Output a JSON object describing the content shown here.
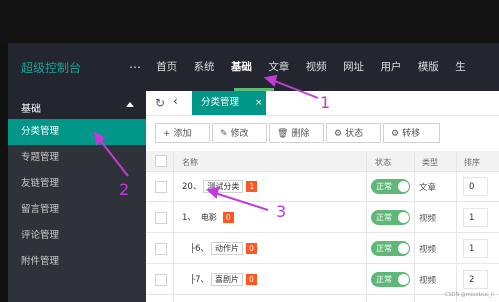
{
  "header": {
    "brand": "超级控制台",
    "more": "…",
    "nav": [
      "首页",
      "系统",
      "基础",
      "文章",
      "视频",
      "网址",
      "用户",
      "模版",
      "生"
    ],
    "active_nav": "基础"
  },
  "sidebar": {
    "section": "基础",
    "items": [
      "分类管理",
      "专题管理",
      "友链管理",
      "留言管理",
      "评论管理",
      "附件管理"
    ],
    "active_item": "分类管理"
  },
  "tabs": {
    "active_tab": "分类管理",
    "close": "×"
  },
  "toolbar": {
    "add": "添加",
    "edit": "修改",
    "delete": "删除",
    "status": "状态",
    "transfer": "转移"
  },
  "table": {
    "columns": {
      "name": "名称",
      "status": "状态",
      "type": "类型",
      "sort": "排序"
    },
    "rows": [
      {
        "prefix": "20、",
        "label": "测试分类",
        "badge": "1",
        "status": "正常",
        "type": "文章",
        "sort": "0"
      },
      {
        "prefix": "1、",
        "label": "电影",
        "badge": "0",
        "status": "正常",
        "type": "视频",
        "sort": "1"
      },
      {
        "prefix": "├6、",
        "label": "动作片",
        "badge": "0",
        "status": "正常",
        "type": "视频",
        "sort": "1"
      },
      {
        "prefix": "├7、",
        "label": "喜剧片",
        "badge": "0",
        "status": "正常",
        "type": "视频",
        "sort": "2"
      }
    ]
  },
  "annotations": [
    "1",
    "2",
    "3"
  ],
  "watermark": "CSDN @moudzuc_li",
  "colors": {
    "accent": "#009688",
    "header_bg": "#23262e",
    "sidebar_bg": "#2f3238",
    "switch_on": "#5fb878",
    "badge": "#ff5722",
    "arrow": "#c03cd8"
  }
}
